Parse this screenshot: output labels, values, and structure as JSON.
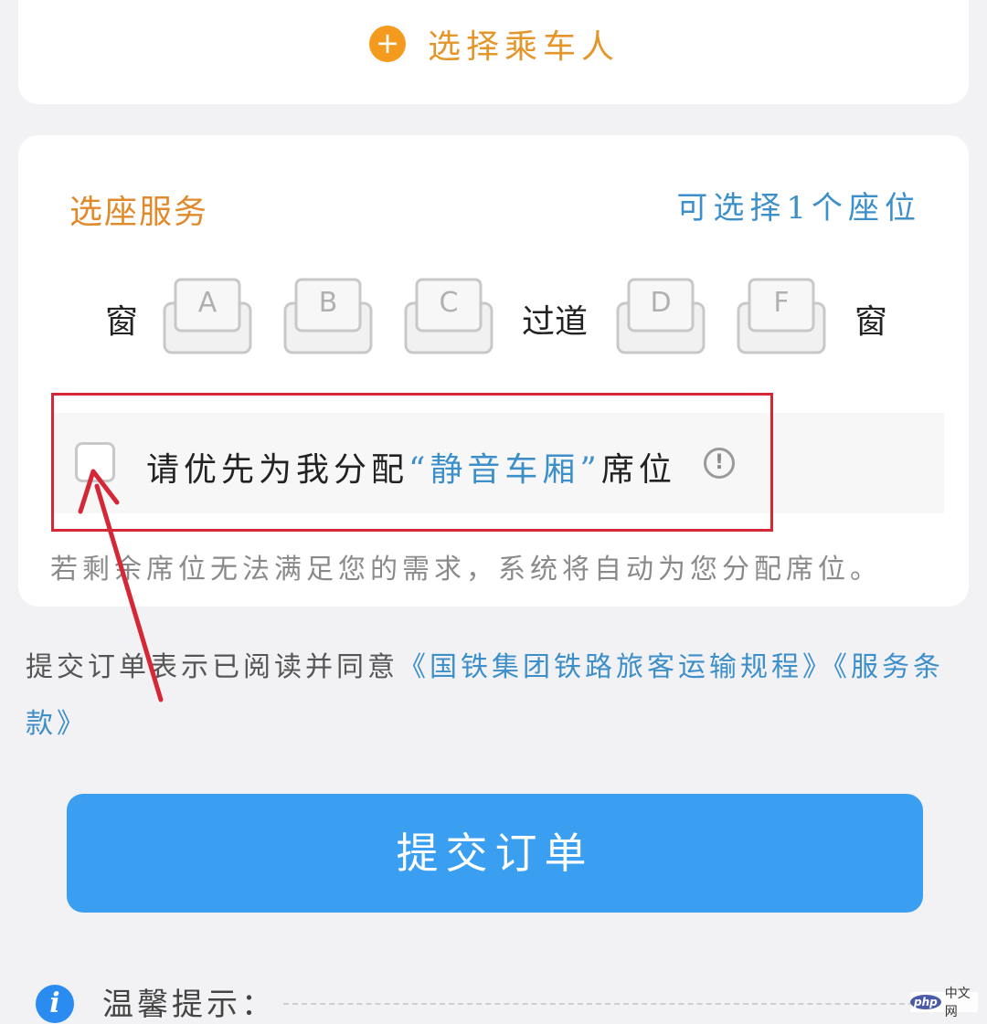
{
  "passenger": {
    "add_label": "选择乘车人"
  },
  "seat_service": {
    "title": "选座服务",
    "count_hint": "可选择1个座位",
    "window_left": "窗",
    "aisle": "过道",
    "window_right": "窗",
    "seats": [
      "A",
      "B",
      "C",
      "D",
      "F"
    ]
  },
  "quiet_car": {
    "text_before": "请优先为我分配",
    "highlight": "“静音车厢”",
    "text_after": "席位",
    "info_icon": "!"
  },
  "notice": "若剩余席位无法满足您的需求，系统将自动为您分配席位。",
  "agreement": {
    "prefix": "提交订单表示已阅读并同意",
    "link1": "《国铁集团铁路旅客运输规程》",
    "link2": "《服务条款》"
  },
  "submit_label": "提交订单",
  "tips": {
    "icon": "i",
    "label": "温馨提示："
  },
  "watermark": {
    "logo": "php",
    "site": "中文网"
  },
  "colors": {
    "accent_orange": "#e08a2c",
    "link_blue": "#3d8fc9",
    "button_blue": "#3b9ff1",
    "annotation_red": "#d52837"
  },
  "icons": {
    "add": "plus-circle-icon",
    "seat": "seat-icon",
    "info": "exclamation-circle-icon",
    "tip": "info-icon",
    "annotation": "arrow-annotation-icon"
  }
}
